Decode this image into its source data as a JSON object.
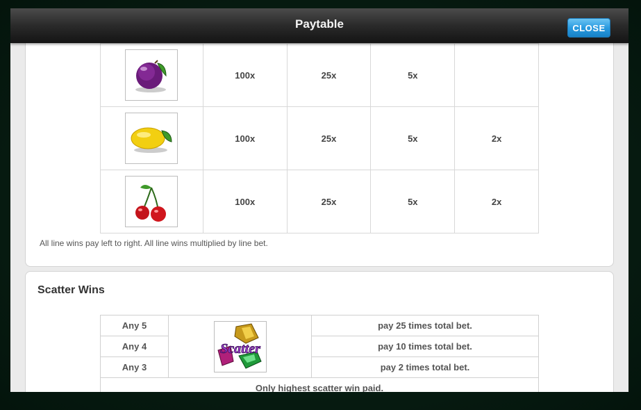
{
  "header": {
    "title": "Paytable",
    "close_label": "CLOSE"
  },
  "line_wins": {
    "rows": [
      {
        "symbol_icon": "plum-icon",
        "values": [
          "100x",
          "25x",
          "5x",
          ""
        ]
      },
      {
        "symbol_icon": "lemon-icon",
        "values": [
          "100x",
          "25x",
          "5x",
          "2x"
        ]
      },
      {
        "symbol_icon": "cherries-icon",
        "values": [
          "100x",
          "25x",
          "5x",
          "2x"
        ]
      }
    ],
    "note": "All line wins pay left to right. All line wins multiplied by line bet."
  },
  "scatter": {
    "title": "Scatter Wins",
    "symbol_text": "Scatter",
    "rows": [
      {
        "label": "Any 5",
        "pay": "pay 25 times total bet."
      },
      {
        "label": "Any 4",
        "pay": "pay 10 times total bet."
      },
      {
        "label": "Any 3",
        "pay": "pay 2 times total bet."
      }
    ],
    "footer": "Only highest scatter win paid."
  }
}
